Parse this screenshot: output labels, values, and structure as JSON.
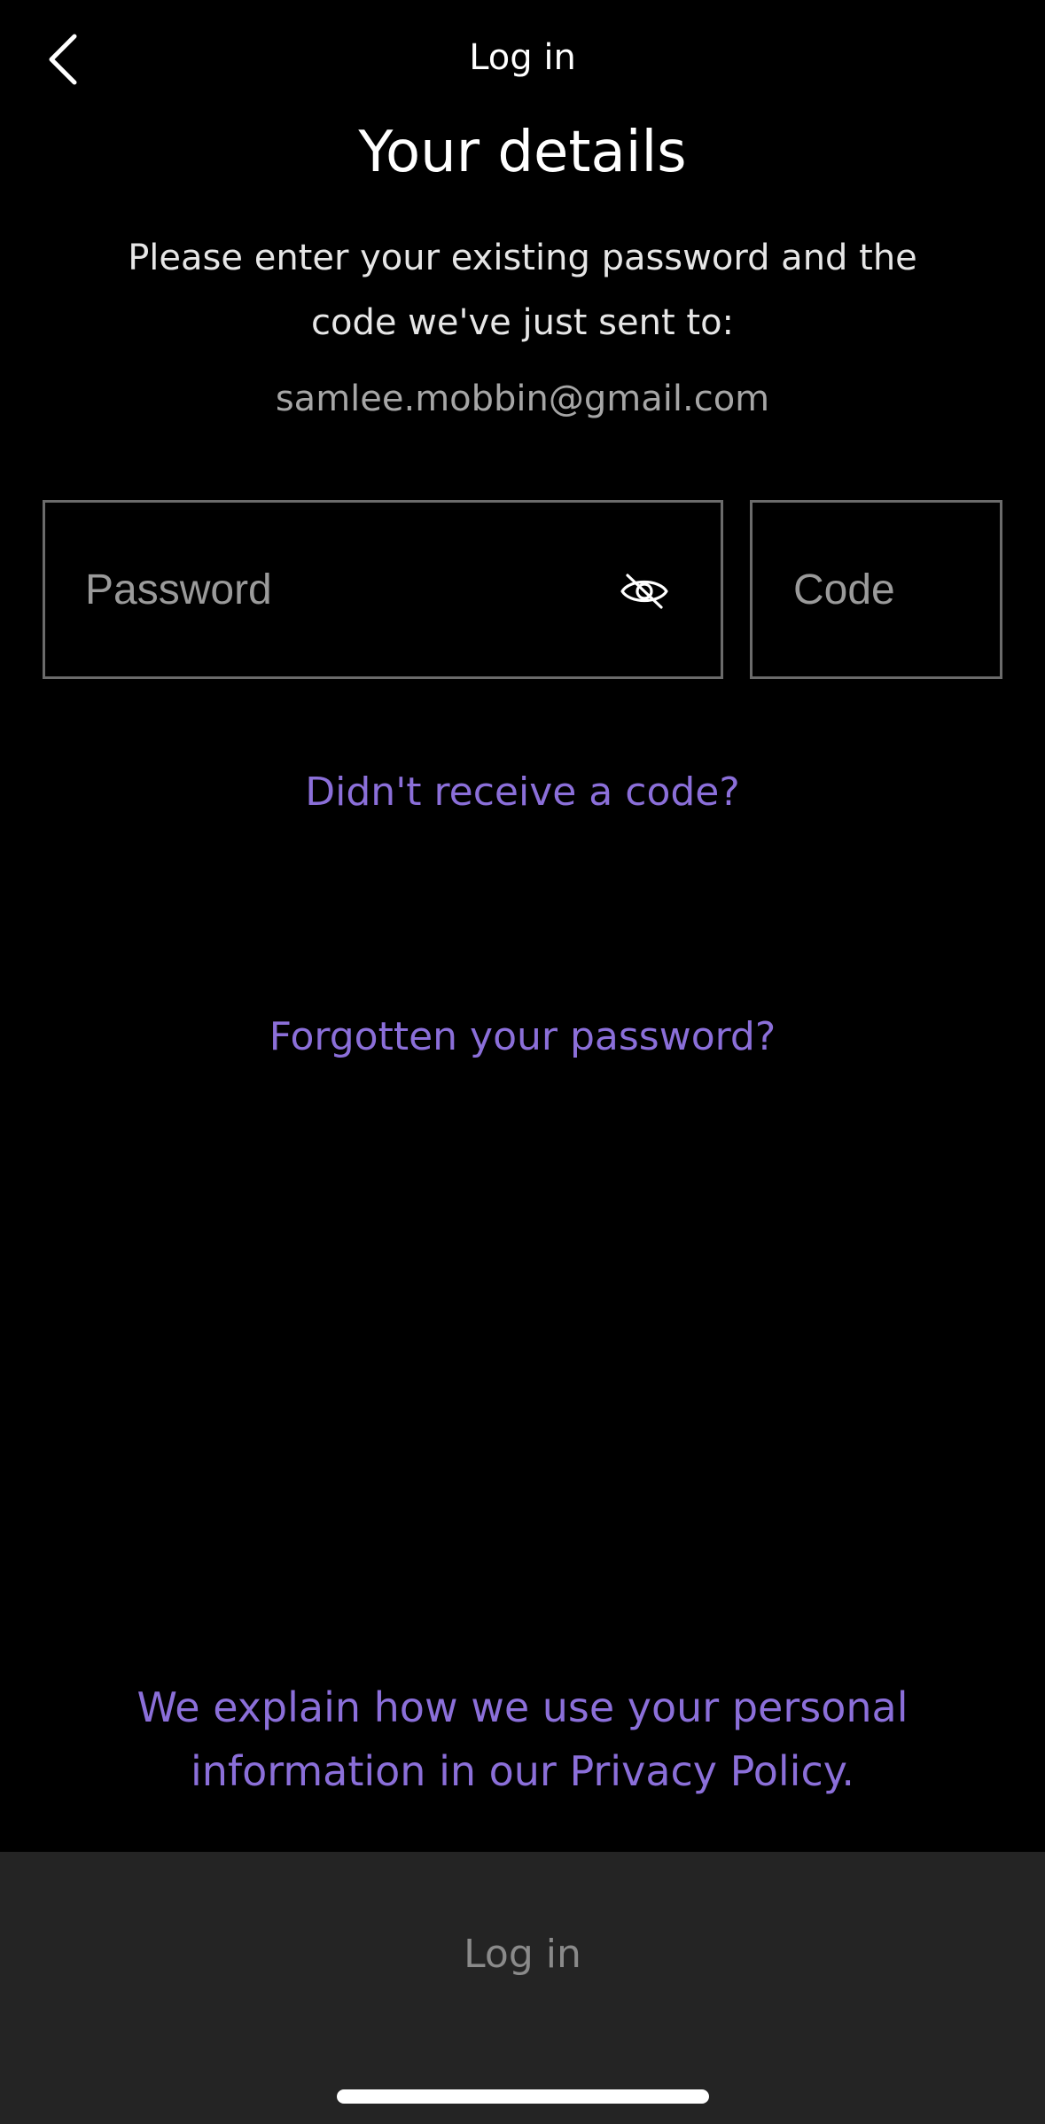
{
  "nav": {
    "title": "Log in",
    "back_icon": "chevron-left-icon"
  },
  "heading": "Your details",
  "instructions": "Please enter your existing password and the code we've just sent to:",
  "email": "samlee.mobbin@gmail.com",
  "password_field": {
    "placeholder": "Password",
    "value": "",
    "toggle_icon": "eye-off-icon"
  },
  "code_field": {
    "placeholder": "Code",
    "value": ""
  },
  "links": {
    "resend_code": "Didn't receive a code?",
    "forgot_password": "Forgotten your password?"
  },
  "privacy_text": "We explain how we use your personal information in our Privacy Policy.",
  "footer": {
    "login_label": "Log in"
  },
  "colors": {
    "background": "#000000",
    "accent": "#8b6fd9",
    "footer_bg": "#242424",
    "disabled_text": "#8a8a8a"
  }
}
